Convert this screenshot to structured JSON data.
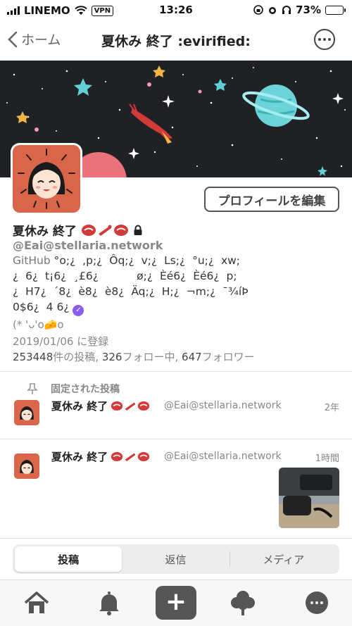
{
  "status_bar": {
    "carrier": "LINEMO",
    "vpn": "VPN",
    "time": "13:26",
    "battery": "73%",
    "battery_level": 0.73
  },
  "nav": {
    "back_label": "ホーム",
    "title": "夏休み 終了 :evirified:"
  },
  "profile": {
    "display_name": "夏休み 終了",
    "handle": "@Eai@stellaria.network",
    "edit_button": "プロフィールを編集",
    "bio_line1_prefix": "GitHub",
    "bio_line1": " °o;¿  ,p;¿  Ôq;¿  v;¿  Ls;¿  °u;¿  xw;",
    "bio_line2": "¿  6¿  t¡6¿  ¸£6¿           ø;¿  Èé6¿  Èé6¿  p;",
    "bio_line3": "¿  H7¿  ´8¿  è8¿  è8¿  Äq;¿  H;¿  ¬m;¿  ¯¾íÞ",
    "bio_line4": "0$6¿  4 6¿",
    "kaomoji": "(* 'ᴗ'o🧀o",
    "joined": "2019/01/06 に登録",
    "posts_count": "253448",
    "posts_label": "件の投稿,",
    "following_count": "326",
    "following_label": "フォロー中,",
    "followers_count": "647",
    "followers_label": "フォロワー"
  },
  "pinned": {
    "label": "固定された投稿",
    "name": "夏休み 終了",
    "handle": "@Eai@stellaria.network",
    "time": "2年"
  },
  "post": {
    "name": "夏休み 終了",
    "handle": "@Eai@stellaria.network",
    "time": "1時間"
  },
  "tabs": [
    "投稿",
    "返信",
    "メディア"
  ],
  "bottom_nav": [
    "home-icon",
    "bell-icon",
    "compose-button",
    "tree-icon",
    "more-icon"
  ],
  "colors": {
    "accent_avatar": "#d9654a",
    "banner": "#202124",
    "verified": "#8a5cf5"
  }
}
